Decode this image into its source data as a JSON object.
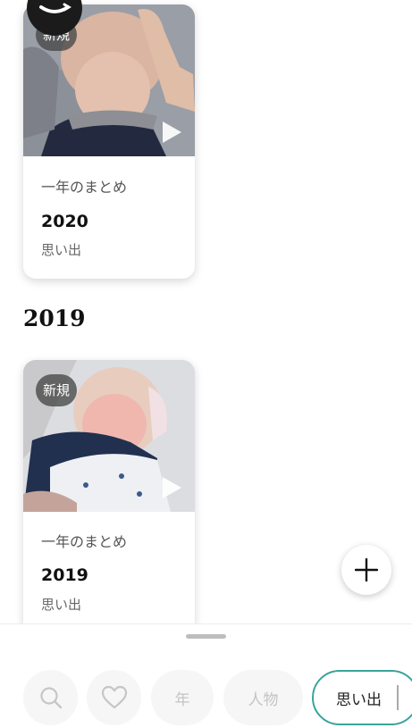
{
  "cards": [
    {
      "badge": "新規",
      "subtitle": "一年のまとめ",
      "year": "2020",
      "type": "思い出"
    },
    {
      "badge": "新規",
      "subtitle": "一年のまとめ",
      "year": "2019",
      "type": "思い出"
    }
  ],
  "section_header": "2019",
  "bottom_nav": {
    "year_label": "年",
    "people_label": "人物",
    "memories_label": "思い出"
  },
  "colors": {
    "accent": "#3aa39b",
    "fab_icon": "#111111"
  },
  "icons": {
    "search": "search-icon",
    "favorite": "heart-icon",
    "add": "plus-icon",
    "play": "play-icon",
    "logo": "amazon-smile-icon"
  }
}
